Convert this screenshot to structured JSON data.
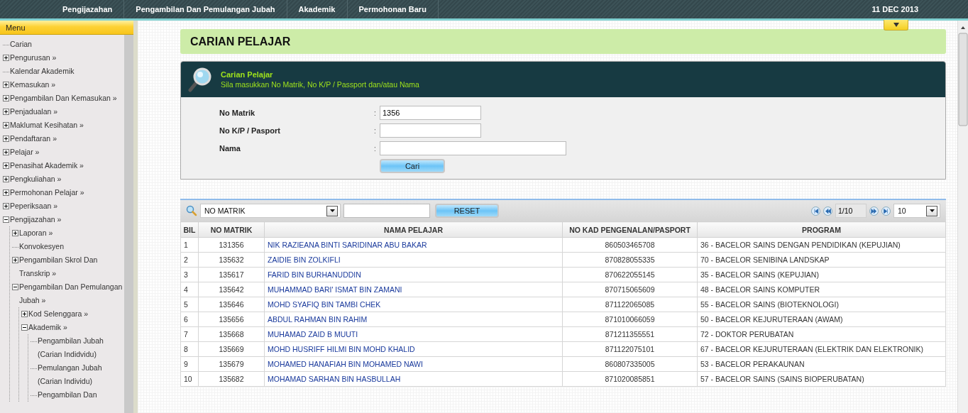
{
  "breadcrumb": [
    "Pengijazahan",
    "Pengambilan Dan Pemulangan Jubah",
    "Akademik",
    "Permohonan Baru"
  ],
  "date": "11 DEC 2013",
  "menu": {
    "title": "Menu",
    "items": [
      {
        "label": "Carian"
      },
      {
        "label": "Pengurusan »",
        "expanded": false
      },
      {
        "label": "Kalendar Akademik"
      },
      {
        "label": "Kemasukan »",
        "expanded": false
      },
      {
        "label": "Pengambilan Dan Kemasukan »",
        "expanded": false
      },
      {
        "label": "Penjadualan »",
        "expanded": false
      },
      {
        "label": "Maklumat Kesihatan »",
        "expanded": false
      },
      {
        "label": "Pendaftaran »",
        "expanded": false
      },
      {
        "label": "Pelajar »",
        "expanded": false
      },
      {
        "label": "Penasihat Akademik »",
        "expanded": false
      },
      {
        "label": "Pengkuliahan »",
        "expanded": false
      },
      {
        "label": "Permohonan Pelajar »",
        "expanded": false
      },
      {
        "label": "Peperiksaan »",
        "expanded": false
      },
      {
        "label": "Pengijazahan »",
        "expanded": true,
        "children": [
          {
            "label": "Laporan »",
            "expanded": false
          },
          {
            "label": "Konvokesyen"
          },
          {
            "label": "Pengambilan Skrol Dan Transkrip »",
            "expanded": false
          },
          {
            "label": "Pengambilan Dan Pemulangan Jubah »",
            "expanded": true,
            "children": [
              {
                "label": "Kod Selenggara »",
                "expanded": false
              },
              {
                "label": "Akademik »",
                "expanded": true,
                "children": [
                  {
                    "label": "Pengambilan Jubah (Carian Indidvidu)"
                  },
                  {
                    "label": "Pemulangan Jubah (Carian Individu)"
                  },
                  {
                    "label": "Pengambilan Dan"
                  }
                ]
              }
            ]
          }
        ]
      }
    ]
  },
  "page_title": "CARIAN PELAJAR",
  "search_panel": {
    "title": "Carian Pelajar",
    "subtitle": "Sila masukkan No Matrik, No K/P / Passport dan/atau Nama",
    "fields": [
      {
        "label": "No Matrik",
        "value": "1356"
      },
      {
        "label": "No K/P / Pasport"
      },
      {
        "label": "Nama"
      }
    ],
    "separator": ":",
    "button": "Cari"
  },
  "table": {
    "filter": "NO MATRIK",
    "reset_button": "RESET",
    "page": "1/10",
    "page_size": "10",
    "columns": [
      "BIL",
      "NO MATRIK",
      "NAMA PELAJAR",
      "NO KAD PENGENALAN/PASPORT",
      "PROGRAM"
    ],
    "rows": [
      [
        "1",
        "131356",
        "NIK RAZIEANA BINTI SARIDINAR ABU BAKAR",
        "860503465708",
        "36 - BACELOR SAINS DENGAN PENDIDIKAN (KEPUJIAN)"
      ],
      [
        "2",
        "135632",
        "ZAIDIE BIN ZOLKIFLI",
        "870828055335",
        "70 - BACELOR SENIBINA LANDSKAP"
      ],
      [
        "3",
        "135617",
        "FARID BIN BURHANUDDIN",
        "870622055145",
        "35 - BACELOR SAINS (KEPUJIAN)"
      ],
      [
        "4",
        "135642",
        "MUHAMMAD BARI' ISMAT BIN ZAMANI",
        "870715065609",
        "48 - BACELOR SAINS KOMPUTER"
      ],
      [
        "5",
        "135646",
        "MOHD SYAFIQ BIN TAMBI CHEK",
        "871122065085",
        "55 - BACELOR SAINS (BIOTEKNOLOGI)"
      ],
      [
        "6",
        "135656",
        "ABDUL RAHMAN BIN RAHIM",
        "871010066059",
        "50 - BACELOR KEJURUTERAAN (AWAM)"
      ],
      [
        "7",
        "135668",
        "MUHAMAD ZAID B MUUTI",
        "871211355551",
        "72 - DOKTOR PERUBATAN"
      ],
      [
        "8",
        "135669",
        "MOHD HUSRIFF HILMI BIN MOHD KHALID",
        "871122075101",
        "67 - BACELOR KEJURUTERAAN (ELEKTRIK DAN ELEKTRONIK)"
      ],
      [
        "9",
        "135679",
        "MOHAMED HANAFIAH BIN MOHAMED NAWI",
        "860807335005",
        "53 - BACELOR PERAKAUNAN"
      ],
      [
        "10",
        "135682",
        "MOHAMAD SARHAN BIN HASBULLAH",
        "871020085851",
        "57 - BACELOR SAINS (SAINS BIOPERUBATAN)"
      ]
    ]
  }
}
